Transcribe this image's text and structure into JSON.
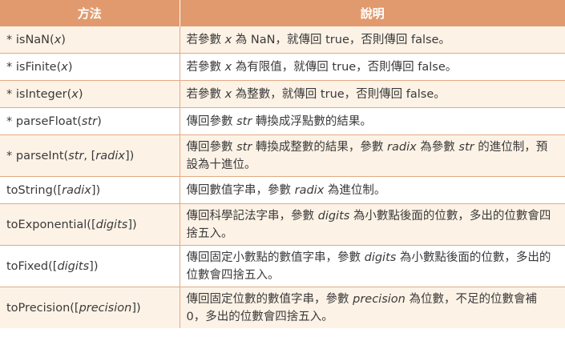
{
  "header": {
    "col_method": "方法",
    "col_desc": "說明"
  },
  "rows": [
    {
      "method": [
        {
          "t": "* isNaN("
        },
        {
          "t": "x",
          "i": true
        },
        {
          "t": ")"
        }
      ],
      "desc": [
        {
          "t": "若參數 "
        },
        {
          "t": "x",
          "i": true
        },
        {
          "t": " 為 NaN，就傳回 true，否則傳回 false。"
        }
      ]
    },
    {
      "method": [
        {
          "t": "* isFinite("
        },
        {
          "t": "x",
          "i": true
        },
        {
          "t": ")"
        }
      ],
      "desc": [
        {
          "t": "若參數 "
        },
        {
          "t": "x",
          "i": true
        },
        {
          "t": " 為有限值，就傳回 true，否則傳回 false。"
        }
      ]
    },
    {
      "method": [
        {
          "t": "* isInteger("
        },
        {
          "t": "x",
          "i": true
        },
        {
          "t": ")"
        }
      ],
      "desc": [
        {
          "t": "若參數 "
        },
        {
          "t": "x",
          "i": true
        },
        {
          "t": " 為整數，就傳回 true，否則傳回 false。"
        }
      ]
    },
    {
      "method": [
        {
          "t": "* parseFloat("
        },
        {
          "t": "str",
          "i": true
        },
        {
          "t": ")"
        }
      ],
      "desc": [
        {
          "t": "傳回參數 "
        },
        {
          "t": "str",
          "i": true
        },
        {
          "t": " 轉換成浮點數的結果。"
        }
      ]
    },
    {
      "method": [
        {
          "t": "* parseInt("
        },
        {
          "t": "str",
          "i": true
        },
        {
          "t": ", ["
        },
        {
          "t": "radix",
          "i": true
        },
        {
          "t": "])"
        }
      ],
      "desc": [
        {
          "t": "傳回參數 "
        },
        {
          "t": "str",
          "i": true
        },
        {
          "t": " 轉換成整數的結果，參數 "
        },
        {
          "t": "radix",
          "i": true
        },
        {
          "t": " 為參數 "
        },
        {
          "t": "str",
          "i": true
        },
        {
          "t": " 的進位制，預設為十進位。"
        }
      ]
    },
    {
      "method": [
        {
          "t": "toString(["
        },
        {
          "t": "radix",
          "i": true
        },
        {
          "t": "])"
        }
      ],
      "desc": [
        {
          "t": "傳回數值字串，參數 "
        },
        {
          "t": "radix",
          "i": true
        },
        {
          "t": " 為進位制。"
        }
      ]
    },
    {
      "method": [
        {
          "t": "toExponential(["
        },
        {
          "t": "digits",
          "i": true
        },
        {
          "t": "])"
        }
      ],
      "desc": [
        {
          "t": "傳回科學記法字串，參數 "
        },
        {
          "t": "digits",
          "i": true
        },
        {
          "t": " 為小數點後面的位數，多出的位數會四捨五入。"
        }
      ]
    },
    {
      "method": [
        {
          "t": "toFixed(["
        },
        {
          "t": "digits",
          "i": true
        },
        {
          "t": "])"
        }
      ],
      "desc": [
        {
          "t": "傳回固定小數點的數值字串，參數 "
        },
        {
          "t": "digits",
          "i": true
        },
        {
          "t": " 為小數點後面的位數，多出的位數會四捨五入。"
        }
      ]
    },
    {
      "method": [
        {
          "t": "toPrecision(["
        },
        {
          "t": "precision",
          "i": true
        },
        {
          "t": "])"
        }
      ],
      "desc": [
        {
          "t": "傳回固定位數的數值字串，參數 "
        },
        {
          "t": "precision",
          "i": true
        },
        {
          "t": " 為位數，不足的位數會補 0，多出的位數會四捨五入。"
        }
      ]
    }
  ]
}
